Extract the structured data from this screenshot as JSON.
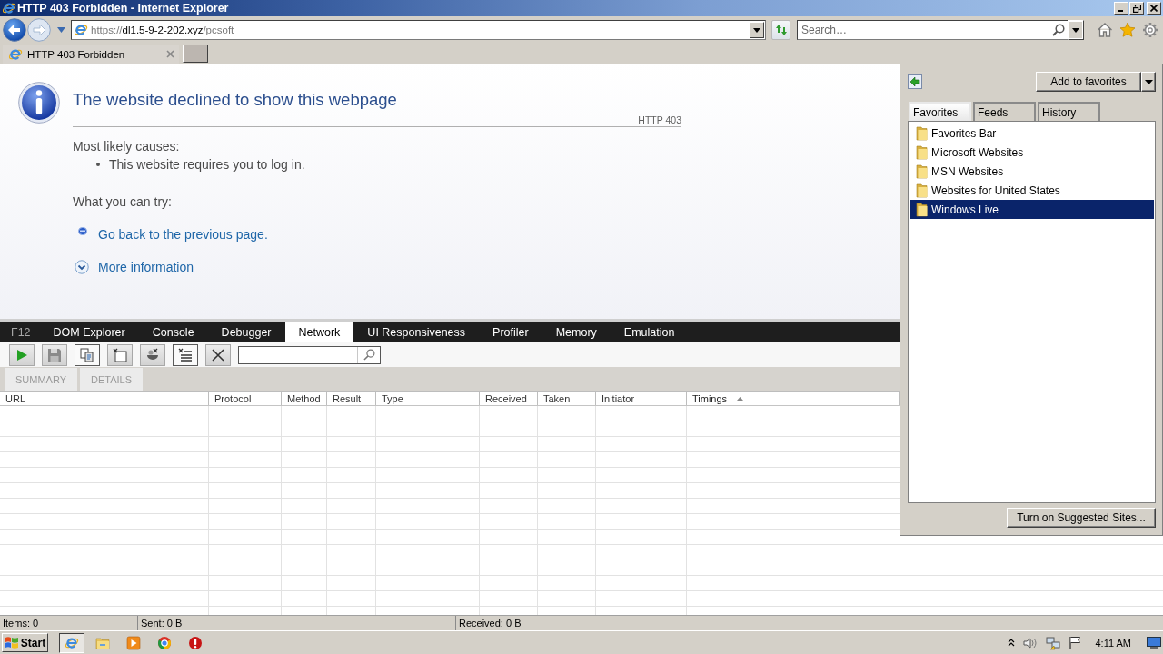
{
  "window": {
    "title": "HTTP 403 Forbidden - Internet Explorer"
  },
  "address_bar": {
    "scheme": "https://",
    "domain": "dl1.5-9-2-202.xyz",
    "path": "/pcsoft"
  },
  "search": {
    "placeholder": "Search…"
  },
  "tabs": [
    {
      "label": "HTTP 403 Forbidden",
      "selected": true
    }
  ],
  "page": {
    "heading": "The website declined to show this webpage",
    "code": "HTTP 403",
    "causes_title": "Most likely causes:",
    "causes": [
      "This website requires you to log in."
    ],
    "try_title": "What you can try:",
    "actions": [
      {
        "kind": "link",
        "label": "Go back to the previous page."
      },
      {
        "kind": "expander",
        "label": "More information"
      }
    ]
  },
  "favorites_center": {
    "add_button": "Add to favorites",
    "tabs": [
      {
        "label": "Favorites",
        "selected": true
      },
      {
        "label": "Feeds",
        "selected": false
      },
      {
        "label": "History",
        "selected": false
      }
    ],
    "items": [
      {
        "label": "Favorites Bar",
        "selected": false
      },
      {
        "label": "Microsoft Websites",
        "selected": false
      },
      {
        "label": "MSN Websites",
        "selected": false
      },
      {
        "label": "Websites for United States",
        "selected": false
      },
      {
        "label": "Windows Live",
        "selected": true
      }
    ],
    "suggested_button": "Turn on Suggested Sites..."
  },
  "devtools": {
    "label": "F12",
    "tabs": [
      {
        "label": "DOM Explorer",
        "selected": false
      },
      {
        "label": "Console",
        "selected": false
      },
      {
        "label": "Debugger",
        "selected": false
      },
      {
        "label": "Network",
        "selected": true
      },
      {
        "label": "UI Responsiveness",
        "selected": false
      },
      {
        "label": "Profiler",
        "selected": false
      },
      {
        "label": "Memory",
        "selected": false
      },
      {
        "label": "Emulation",
        "selected": false
      }
    ],
    "toolbar": [
      {
        "pressed": false
      },
      {
        "pressed": false
      },
      {
        "pressed": true
      },
      {
        "pressed": false
      },
      {
        "pressed": false
      },
      {
        "pressed": true
      },
      {
        "pressed": false
      }
    ],
    "subtabs": [
      {
        "label": "SUMMARY",
        "selected": false
      },
      {
        "label": "DETAILS",
        "selected": false
      }
    ],
    "columns": [
      {
        "label": "URL",
        "sorted": false
      },
      {
        "label": "Protocol",
        "sorted": false
      },
      {
        "label": "Method",
        "sorted": false
      },
      {
        "label": "Result",
        "sorted": false
      },
      {
        "label": "Type",
        "sorted": false
      },
      {
        "label": "Received",
        "sorted": false
      },
      {
        "label": "Taken",
        "sorted": false
      },
      {
        "label": "Initiator",
        "sorted": false
      },
      {
        "label": "Timings",
        "sorted": true
      }
    ]
  },
  "status_bar": [
    "Items: 0",
    "Sent: 0 B",
    "Received: 0 B"
  ],
  "taskbar": {
    "start": "Start",
    "apps": [
      {
        "selected": true
      },
      {
        "selected": false
      },
      {
        "selected": false
      },
      {
        "selected": false
      },
      {
        "selected": false
      }
    ],
    "clock": "4:11 AM"
  }
}
